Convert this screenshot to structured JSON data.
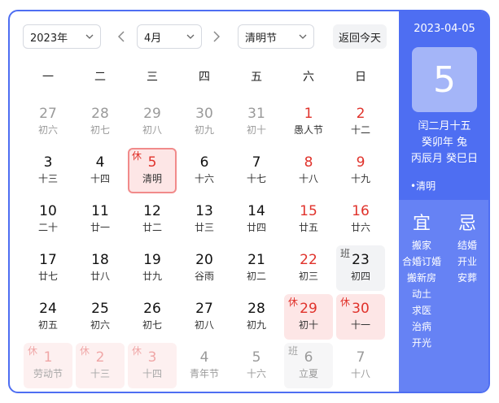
{
  "toolbar": {
    "year": "2023年",
    "month": "4月",
    "holiday": "清明节",
    "today_button": "返回今天"
  },
  "weekdays": [
    "一",
    "二",
    "三",
    "四",
    "五",
    "六",
    "日"
  ],
  "days": [
    {
      "num": "27",
      "lunar": "初六",
      "state": "other"
    },
    {
      "num": "28",
      "lunar": "初七",
      "state": "other"
    },
    {
      "num": "29",
      "lunar": "初八",
      "state": "other"
    },
    {
      "num": "30",
      "lunar": "初九",
      "state": "other"
    },
    {
      "num": "31",
      "lunar": "初十",
      "state": "other"
    },
    {
      "num": "1",
      "lunar": "愚人节",
      "state": "weekend"
    },
    {
      "num": "2",
      "lunar": "十二",
      "state": "weekend"
    },
    {
      "num": "3",
      "lunar": "十三",
      "state": ""
    },
    {
      "num": "4",
      "lunar": "十四",
      "state": ""
    },
    {
      "num": "5",
      "lunar": "清明",
      "state": "selected",
      "badge": "休"
    },
    {
      "num": "6",
      "lunar": "十六",
      "state": ""
    },
    {
      "num": "7",
      "lunar": "十七",
      "state": ""
    },
    {
      "num": "8",
      "lunar": "十八",
      "state": "weekend"
    },
    {
      "num": "9",
      "lunar": "十九",
      "state": "weekend"
    },
    {
      "num": "10",
      "lunar": "二十",
      "state": ""
    },
    {
      "num": "11",
      "lunar": "廿一",
      "state": ""
    },
    {
      "num": "12",
      "lunar": "廿二",
      "state": ""
    },
    {
      "num": "13",
      "lunar": "廿三",
      "state": ""
    },
    {
      "num": "14",
      "lunar": "廿四",
      "state": ""
    },
    {
      "num": "15",
      "lunar": "廿五",
      "state": "weekend"
    },
    {
      "num": "16",
      "lunar": "廿六",
      "state": "weekend"
    },
    {
      "num": "17",
      "lunar": "廿七",
      "state": ""
    },
    {
      "num": "18",
      "lunar": "廿八",
      "state": ""
    },
    {
      "num": "19",
      "lunar": "廿九",
      "state": ""
    },
    {
      "num": "20",
      "lunar": "谷雨",
      "state": ""
    },
    {
      "num": "21",
      "lunar": "初二",
      "state": ""
    },
    {
      "num": "22",
      "lunar": "初三",
      "state": "weekend"
    },
    {
      "num": "23",
      "lunar": "初四",
      "state": "workday",
      "badge": "班"
    },
    {
      "num": "24",
      "lunar": "初五",
      "state": ""
    },
    {
      "num": "25",
      "lunar": "初六",
      "state": ""
    },
    {
      "num": "26",
      "lunar": "初七",
      "state": ""
    },
    {
      "num": "27",
      "lunar": "初八",
      "state": ""
    },
    {
      "num": "28",
      "lunar": "初九",
      "state": ""
    },
    {
      "num": "29",
      "lunar": "初十",
      "state": "holiday",
      "badge": "休"
    },
    {
      "num": "30",
      "lunar": "十一",
      "state": "holiday",
      "badge": "休"
    },
    {
      "num": "1",
      "lunar": "劳动节",
      "state": "other holiday",
      "badge": "休"
    },
    {
      "num": "2",
      "lunar": "十三",
      "state": "other holiday",
      "badge": "休"
    },
    {
      "num": "3",
      "lunar": "十四",
      "state": "other holiday",
      "badge": "休"
    },
    {
      "num": "4",
      "lunar": "青年节",
      "state": "other"
    },
    {
      "num": "5",
      "lunar": "十六",
      "state": "other"
    },
    {
      "num": "6",
      "lunar": "立夏",
      "state": "other workday",
      "badge": "班"
    },
    {
      "num": "7",
      "lunar": "十八",
      "state": "other"
    }
  ],
  "panel": {
    "date": "2023-04-05",
    "day": "5",
    "lunar_date": "闰二月十五",
    "year_ganzhi": "癸卯年 兔",
    "month_day_ganzhi": "丙辰月 癸巳日",
    "festival": "•清明",
    "yi_title": "宜",
    "ji_title": "忌",
    "yi": [
      "搬家",
      "合婚订婚",
      "搬新房",
      "动土",
      "求医",
      "治病",
      "开光"
    ],
    "ji": [
      "结婚",
      "开业",
      "安葬"
    ]
  },
  "colors": {
    "accent": "#4e6ef2",
    "panel_bottom": "#6682f4",
    "holiday_red": "#e0322b",
    "holiday_bg": "#fde6e6"
  }
}
